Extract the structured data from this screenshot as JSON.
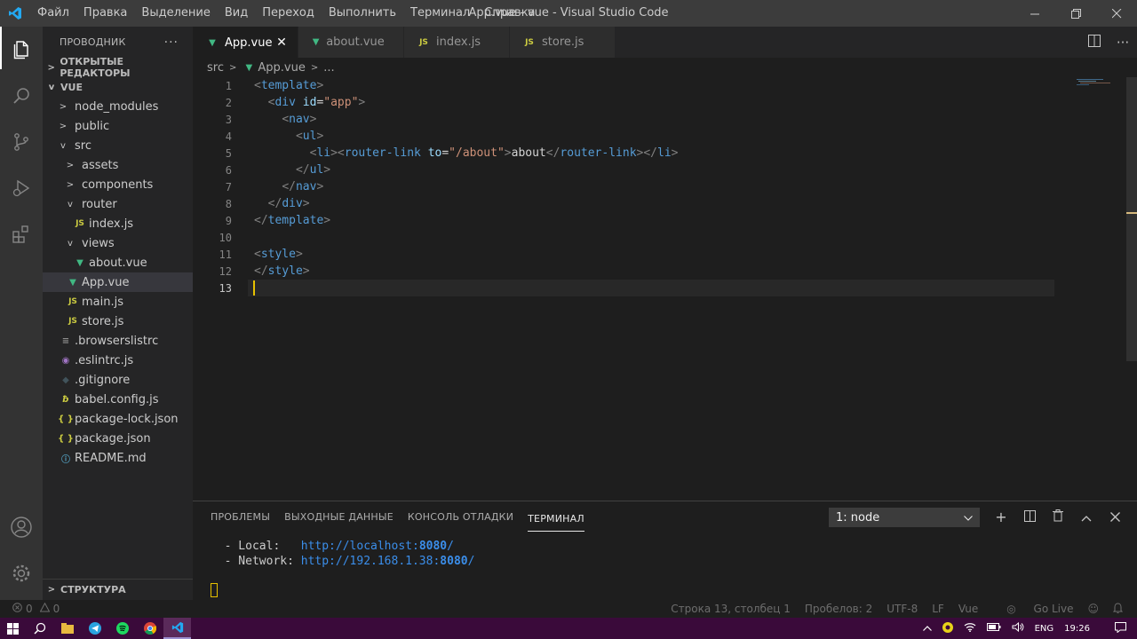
{
  "titlebar": {
    "menu": [
      "Файл",
      "Правка",
      "Выделение",
      "Вид",
      "Переход",
      "Выполнить",
      "Терминал",
      "Справка"
    ],
    "title": "App.vue - vue - Visual Studio Code"
  },
  "sidebar": {
    "header": "ПРОВОДНИК",
    "open_editors": "ОТКРЫТЫЕ РЕДАКТОРЫ",
    "project": "VUE",
    "tree": [
      {
        "label": "node_modules",
        "depth": 1,
        "twisty": ">",
        "icon": ""
      },
      {
        "label": "public",
        "depth": 1,
        "twisty": ">",
        "icon": ""
      },
      {
        "label": "src",
        "depth": 1,
        "twisty": "v",
        "icon": ""
      },
      {
        "label": "assets",
        "depth": 2,
        "twisty": ">",
        "icon": ""
      },
      {
        "label": "components",
        "depth": 2,
        "twisty": ">",
        "icon": ""
      },
      {
        "label": "router",
        "depth": 2,
        "twisty": "v",
        "icon": ""
      },
      {
        "label": "index.js",
        "depth": 3,
        "twisty": "",
        "icon": "js"
      },
      {
        "label": "views",
        "depth": 2,
        "twisty": "v",
        "icon": ""
      },
      {
        "label": "about.vue",
        "depth": 3,
        "twisty": "",
        "icon": "vue"
      },
      {
        "label": "App.vue",
        "depth": 2,
        "twisty": "",
        "icon": "vue",
        "selected": true
      },
      {
        "label": "main.js",
        "depth": 2,
        "twisty": "",
        "icon": "js"
      },
      {
        "label": "store.js",
        "depth": 2,
        "twisty": "",
        "icon": "js"
      },
      {
        "label": ".browserslistrc",
        "depth": 1,
        "twisty": "",
        "icon": "lines"
      },
      {
        "label": ".eslintrc.js",
        "depth": 1,
        "twisty": "",
        "icon": "eslint"
      },
      {
        "label": ".gitignore",
        "depth": 1,
        "twisty": "",
        "icon": "git"
      },
      {
        "label": "babel.config.js",
        "depth": 1,
        "twisty": "",
        "icon": "babel"
      },
      {
        "label": "package-lock.json",
        "depth": 1,
        "twisty": "",
        "icon": "json"
      },
      {
        "label": "package.json",
        "depth": 1,
        "twisty": "",
        "icon": "json"
      },
      {
        "label": "README.md",
        "depth": 1,
        "twisty": "",
        "icon": "info"
      }
    ],
    "outline": "СТРУКТУРА"
  },
  "tabs": [
    {
      "label": "App.vue",
      "icon": "vue",
      "active": true
    },
    {
      "label": "about.vue",
      "icon": "vue",
      "active": false
    },
    {
      "label": "index.js",
      "icon": "js",
      "active": false
    },
    {
      "label": "store.js",
      "icon": "js",
      "active": false
    }
  ],
  "breadcrumb": {
    "folder": "src",
    "file": "App.vue",
    "more": "..."
  },
  "editor": {
    "current_line": 13,
    "lines": [
      [
        [
          "t-br",
          "<"
        ],
        [
          "t-tag",
          "template"
        ],
        [
          "t-br",
          ">"
        ]
      ],
      [
        [
          "t-txt",
          "  "
        ],
        [
          "t-br",
          "<"
        ],
        [
          "t-tag",
          "div"
        ],
        [
          "t-txt",
          " "
        ],
        [
          "t-attr",
          "id"
        ],
        [
          "t-txt",
          "="
        ],
        [
          "t-str",
          "\"app\""
        ],
        [
          "t-br",
          ">"
        ]
      ],
      [
        [
          "t-txt",
          "    "
        ],
        [
          "t-br",
          "<"
        ],
        [
          "t-tag",
          "nav"
        ],
        [
          "t-br",
          ">"
        ]
      ],
      [
        [
          "t-txt",
          "      "
        ],
        [
          "t-br",
          "<"
        ],
        [
          "t-tag",
          "ul"
        ],
        [
          "t-br",
          ">"
        ]
      ],
      [
        [
          "t-txt",
          "        "
        ],
        [
          "t-br",
          "<"
        ],
        [
          "t-tag",
          "li"
        ],
        [
          "t-br",
          "><"
        ],
        [
          "t-tag",
          "router-link"
        ],
        [
          "t-txt",
          " "
        ],
        [
          "t-attr",
          "to"
        ],
        [
          "t-txt",
          "="
        ],
        [
          "t-str",
          "\"/about\""
        ],
        [
          "t-br",
          ">"
        ],
        [
          "t-txt",
          "about"
        ],
        [
          "t-br",
          "</"
        ],
        [
          "t-tag",
          "router-link"
        ],
        [
          "t-br",
          "></"
        ],
        [
          "t-tag",
          "li"
        ],
        [
          "t-br",
          ">"
        ]
      ],
      [
        [
          "t-txt",
          "      "
        ],
        [
          "t-br",
          "</"
        ],
        [
          "t-tag",
          "ul"
        ],
        [
          "t-br",
          ">"
        ]
      ],
      [
        [
          "t-txt",
          "    "
        ],
        [
          "t-br",
          "</"
        ],
        [
          "t-tag",
          "nav"
        ],
        [
          "t-br",
          ">"
        ]
      ],
      [
        [
          "t-txt",
          "  "
        ],
        [
          "t-br",
          "</"
        ],
        [
          "t-tag",
          "div"
        ],
        [
          "t-br",
          ">"
        ]
      ],
      [
        [
          "t-br",
          "</"
        ],
        [
          "t-tag",
          "template"
        ],
        [
          "t-br",
          ">"
        ]
      ],
      [],
      [
        [
          "t-br",
          "<"
        ],
        [
          "t-tag",
          "style"
        ],
        [
          "t-br",
          ">"
        ]
      ],
      [
        [
          "t-br",
          "</"
        ],
        [
          "t-tag",
          "style"
        ],
        [
          "t-br",
          ">"
        ]
      ],
      []
    ]
  },
  "panel": {
    "tabs": [
      "ПРОБЛЕМЫ",
      "ВЫХОДНЫЕ ДАННЫЕ",
      "КОНСОЛЬ ОТЛАДКИ",
      "ТЕРМИНАЛ"
    ],
    "active_tab": 3,
    "terminal_select": "1: node",
    "terminal": {
      "local_label": "  - Local:   ",
      "local_url": "http://localhost:",
      "local_port": "8080",
      "network_label": "  - Network: ",
      "network_url": "http://192.168.1.38:",
      "network_port": "8080",
      "slash": "/"
    }
  },
  "statusbar": {
    "errors": "0",
    "warnings": "0",
    "position": "Строка 13, столбец 1",
    "spaces": "Пробелов: 2",
    "encoding": "UTF-8",
    "eol": "LF",
    "language": "Vue",
    "golive": "Go Live"
  },
  "taskbar": {
    "lang": "ENG",
    "time": "19:26"
  },
  "colors": {
    "accent": "#007acc",
    "vue_green": "#41b883",
    "js_yellow": "#cbcb41",
    "taskbar_bg": "#3a0a3a"
  }
}
